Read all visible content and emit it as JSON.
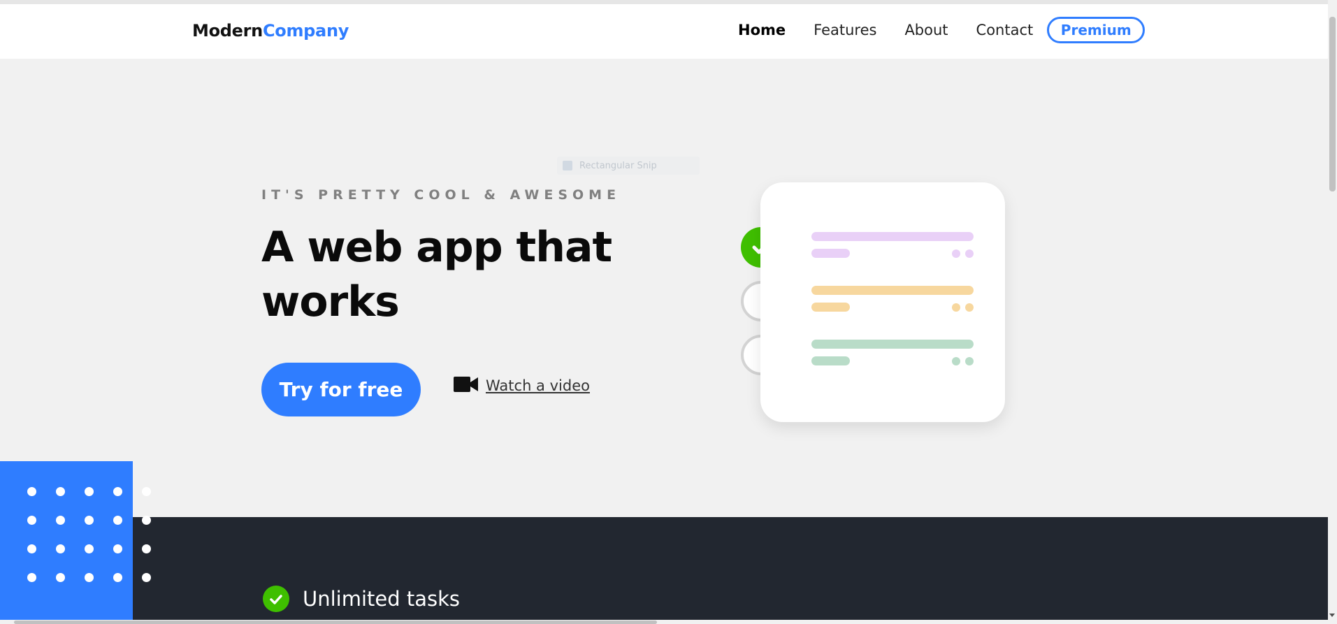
{
  "brand": {
    "part1": "Modern",
    "part2": "Company"
  },
  "nav": {
    "items": [
      "Home",
      "Features",
      "About",
      "Contact"
    ],
    "active": "Home",
    "premium_label": "Premium"
  },
  "hero": {
    "overline": "IT'S PRETTY COOL & AWESOME",
    "title": "A web app that works",
    "cta_label": "Try for free",
    "video_label": "Watch a video"
  },
  "faded_label": "Rectangular Snip",
  "task_card": {
    "rows": [
      {
        "status": "done",
        "color": "#e9d0f7"
      },
      {
        "status": "todo",
        "color": "#f7d79e"
      },
      {
        "status": "todo",
        "color": "#b9dcc8"
      }
    ]
  },
  "features": {
    "items": [
      "Unlimited tasks"
    ]
  },
  "colors": {
    "accent": "#2f7dff",
    "success": "#3fbf00",
    "dark": "#222730",
    "background": "#f1f1f1"
  },
  "icons": {
    "video": "video-camera-icon",
    "check": "checkmark-icon"
  }
}
